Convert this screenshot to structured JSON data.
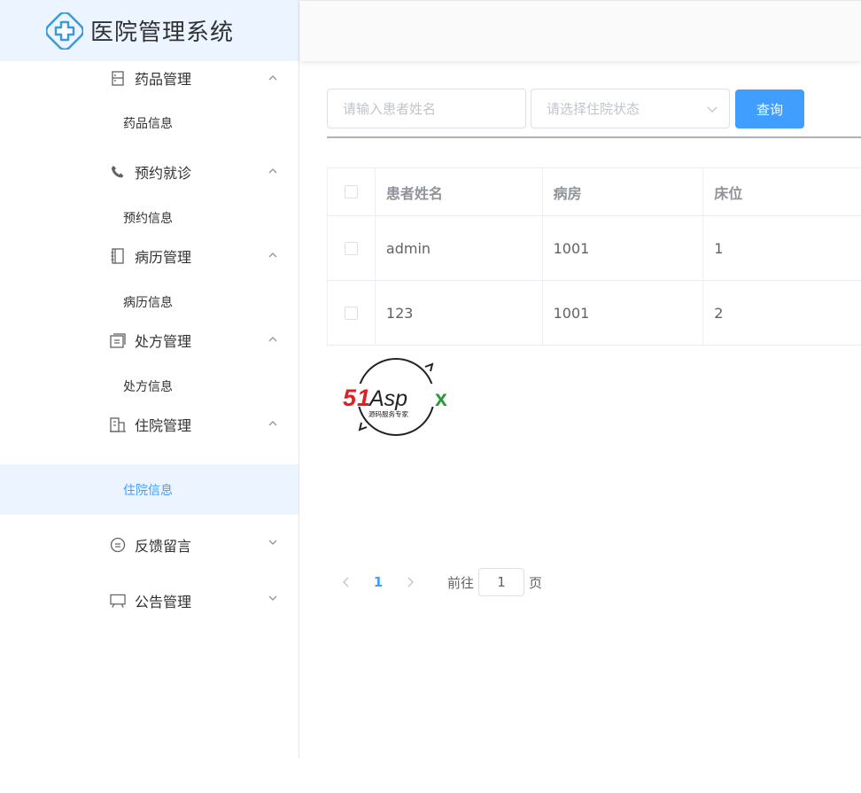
{
  "app": {
    "title": "医院管理系统"
  },
  "sidebar": {
    "groups": [
      {
        "label": "药品管理",
        "icon": "cabinet-icon",
        "expanded": true,
        "sub": [
          "药品信息"
        ]
      },
      {
        "label": "预约就诊",
        "icon": "phone-icon",
        "expanded": true,
        "sub": [
          "预约信息"
        ]
      },
      {
        "label": "病历管理",
        "icon": "notebook-icon",
        "expanded": true,
        "sub": [
          "病历信息"
        ]
      },
      {
        "label": "处方管理",
        "icon": "document-icon",
        "expanded": true,
        "sub": [
          "处方信息"
        ]
      },
      {
        "label": "住院管理",
        "icon": "building-icon",
        "expanded": true,
        "sub": [
          "住院信息"
        ]
      },
      {
        "label": "反馈留言",
        "icon": "chat-icon",
        "expanded": false,
        "sub": []
      },
      {
        "label": "公告管理",
        "icon": "board-icon",
        "expanded": false,
        "sub": []
      }
    ],
    "active_sub": "住院信息"
  },
  "search": {
    "name_placeholder": "请输入患者姓名",
    "name_value": "",
    "status_placeholder": "请选择住院状态",
    "query_label": "查询"
  },
  "table": {
    "columns": [
      "患者姓名",
      "病房",
      "床位"
    ],
    "rows": [
      {
        "name": "admin",
        "room": "1001",
        "bed": "1"
      },
      {
        "name": "123",
        "room": "1001",
        "bed": "2"
      }
    ]
  },
  "watermark": {
    "main": "51Aspx",
    "sub": "源码服务专家"
  },
  "pagination": {
    "current_page": "1",
    "goto_label": "前往",
    "goto_value": "1",
    "page_suffix": "页"
  },
  "colors": {
    "primary": "#409eff",
    "active_bg": "#ecf5ff",
    "text": "#303133",
    "muted": "#909399"
  }
}
